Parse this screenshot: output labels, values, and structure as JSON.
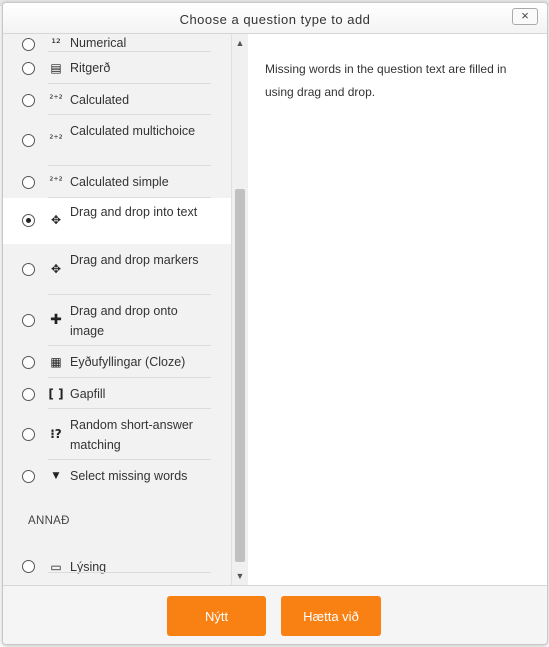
{
  "dialog": {
    "title": "Choose a question type to add",
    "close_label": "×"
  },
  "options": [
    {
      "label": "Numerical",
      "icon": "numerical-icon",
      "glyph": "¹²",
      "selected": false
    },
    {
      "label": "Ritgerð",
      "icon": "essay-icon",
      "glyph": "▤",
      "selected": false
    },
    {
      "label": "Calculated",
      "icon": "calculated-icon",
      "glyph": "²⁺²",
      "selected": false
    },
    {
      "label": "Calculated multichoice",
      "icon": "calculated-multichoice-icon",
      "glyph": "²⁺²",
      "selected": false
    },
    {
      "label": "Calculated simple",
      "icon": "calculated-simple-icon",
      "glyph": "²⁺²",
      "selected": false
    },
    {
      "label": "Drag and drop into text",
      "icon": "drag-drop-text-icon",
      "glyph": "✥",
      "selected": true
    },
    {
      "label": "Drag and drop markers",
      "icon": "drag-drop-markers-icon",
      "glyph": "✥",
      "selected": false
    },
    {
      "label": "Drag and drop onto image",
      "icon": "drag-drop-image-icon",
      "glyph": "✚",
      "selected": false
    },
    {
      "label": "Eyðufyllingar (Cloze)",
      "icon": "cloze-icon",
      "glyph": "▦",
      "selected": false
    },
    {
      "label": "Gapfill",
      "icon": "gapfill-icon",
      "glyph": "[ ]",
      "selected": false
    },
    {
      "label": "Random short-answer matching",
      "icon": "random-match-icon",
      "glyph": "⁝?",
      "selected": false
    },
    {
      "label": "Select missing words",
      "icon": "select-missing-icon",
      "glyph": "▼",
      "selected": false
    }
  ],
  "other_section": {
    "heading": "ANNAÐ",
    "items": [
      {
        "label": "Lýsing",
        "icon": "description-icon",
        "glyph": "▭",
        "selected": false
      }
    ]
  },
  "description": "Missing words in the question text are filled in using drag and drop.",
  "footer": {
    "add_label": "Nýtt",
    "cancel_label": "Hætta við"
  },
  "colors": {
    "accent": "#f98012",
    "list_bg": "#f2f2f2",
    "selected_bg": "#ffffff"
  }
}
